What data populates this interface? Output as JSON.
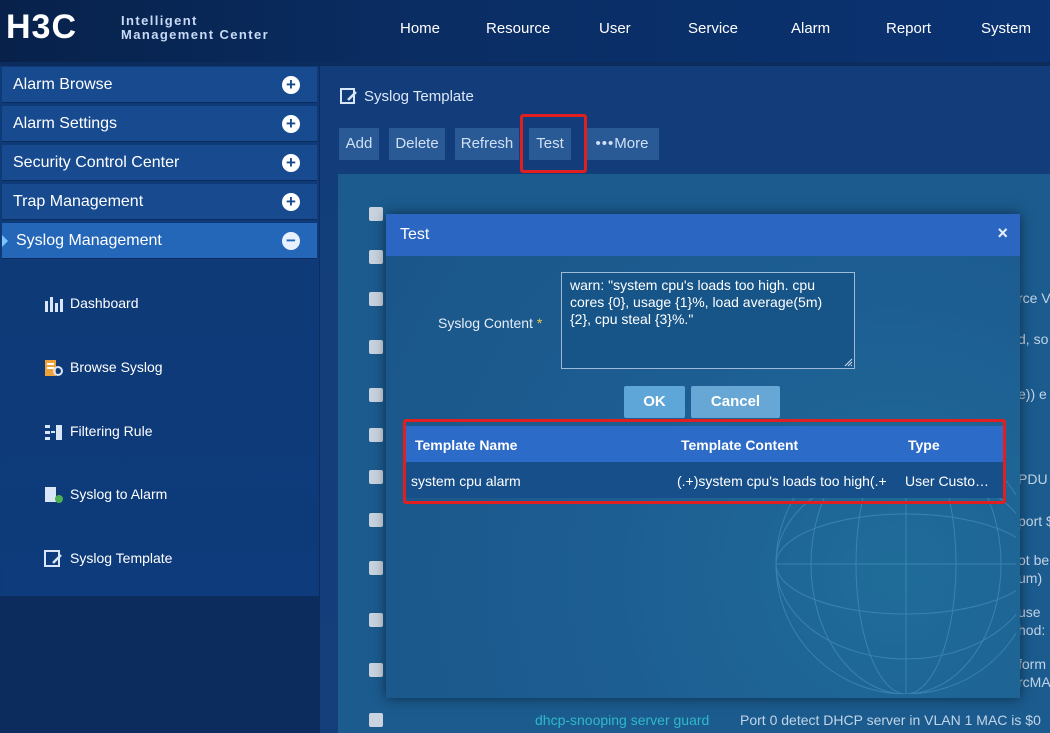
{
  "header": {
    "logo_text": "H3C",
    "brand_line1": "Intelligent",
    "brand_line2": "Management Center",
    "nav": [
      "Home",
      "Resource",
      "User",
      "Service",
      "Alarm",
      "Report",
      "System"
    ]
  },
  "sidebar": {
    "sections": [
      {
        "label": "Alarm Browse",
        "state": "collapsed"
      },
      {
        "label": "Alarm Settings",
        "state": "collapsed"
      },
      {
        "label": "Security Control Center",
        "state": "collapsed"
      },
      {
        "label": "Trap Management",
        "state": "collapsed"
      },
      {
        "label": "Syslog Management",
        "state": "expanded"
      }
    ],
    "submenu": [
      {
        "label": "Dashboard",
        "icon": "dashboard-icon"
      },
      {
        "label": "Browse Syslog",
        "icon": "browse-syslog-icon"
      },
      {
        "label": "Filtering Rule",
        "icon": "filtering-rule-icon"
      },
      {
        "label": "Syslog to Alarm",
        "icon": "syslog-to-alarm-icon"
      },
      {
        "label": "Syslog Template",
        "icon": "syslog-template-icon"
      }
    ]
  },
  "page": {
    "title": "Syslog Template",
    "toolbar": {
      "add": "Add",
      "delete": "Delete",
      "refresh": "Refresh",
      "test": "Test",
      "more": "More"
    },
    "background_rows": {
      "partial_right": [
        "rce V",
        "d, so",
        "e)) e",
        "PDU",
        "port $",
        "ot be",
        "um)",
        "use",
        "hod:",
        "form",
        "rcMA"
      ],
      "last_row_name": "dhcp-snooping server guard",
      "last_row_content": "Port 0 detect DHCP server in VLAN 1 MAC is $0"
    }
  },
  "modal": {
    "title": "Test",
    "close": "×",
    "field_label": "Syslog Content",
    "required_mark": "*",
    "syslog_content": "warn: \"system cpu's loads too high. cpu cores {0}, usage {1}%, load average(5m) {2}, cpu steal {3}%.\"",
    "ok": "OK",
    "cancel": "Cancel",
    "table": {
      "headers": [
        "Template Name",
        "Template Content",
        "Type"
      ],
      "rows": [
        [
          "system cpu alarm",
          "(.+)system cpu's loads too high(.+",
          "User Custo…"
        ]
      ]
    }
  },
  "colors": {
    "accent": "#2a66c2",
    "highlight": "#e02020",
    "link": "#2fb9c9"
  }
}
